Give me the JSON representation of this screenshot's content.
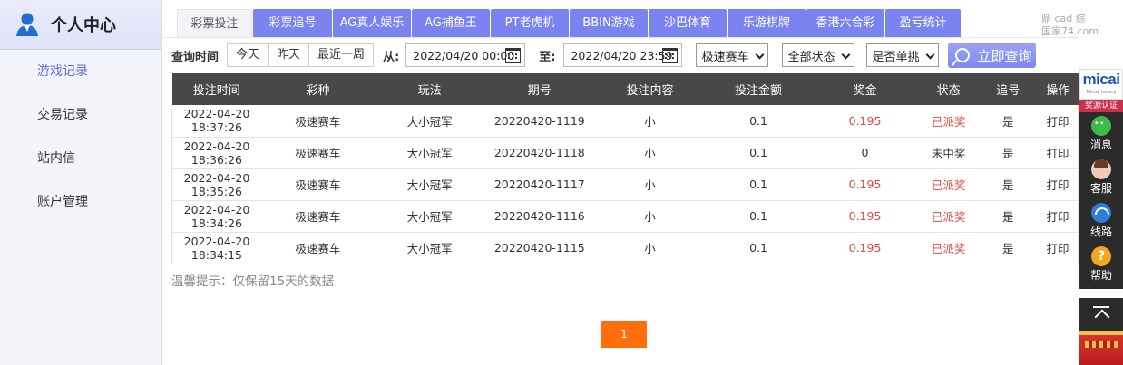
{
  "sidebar": {
    "title": "个人中心",
    "items": [
      {
        "label": "游戏记录",
        "active": true
      },
      {
        "label": "交易记录",
        "active": false
      },
      {
        "label": "站内信",
        "active": false
      },
      {
        "label": "账户管理",
        "active": false
      }
    ]
  },
  "tabs": [
    "彩票投注",
    "彩票追号",
    "AG真人娱乐",
    "AG捕鱼王",
    "PT老虎机",
    "BBIN游戏",
    "沙巴体育",
    "乐游棋牌",
    "香港六合彩",
    "盈亏统计"
  ],
  "filters": {
    "time_label": "查询时间",
    "quick": [
      "今天",
      "昨天",
      "最近一周"
    ],
    "from_label": "从:",
    "from_value": "2022/04/20 00:00",
    "to_label": "至:",
    "to_value": "2022/04/20 23:59",
    "game_select": "极速赛车",
    "status_select": "全部状态",
    "single_select": "是否单挑",
    "query_button": "立即查询"
  },
  "table": {
    "headers": [
      "投注时间",
      "彩种",
      "玩法",
      "期号",
      "投注内容",
      "投注金额",
      "奖金",
      "状态",
      "追号",
      "操作"
    ],
    "rows": [
      [
        "2022-04-20 18:37:26",
        "极速赛车",
        "大小冠军",
        "20220420-1119",
        "小",
        "0.1",
        "0.195",
        "已派奖",
        "是",
        "打印"
      ],
      [
        "2022-04-20 18:36:26",
        "极速赛车",
        "大小冠军",
        "20220420-1118",
        "小",
        "0.1",
        "0",
        "未中奖",
        "是",
        "打印"
      ],
      [
        "2022-04-20 18:35:26",
        "极速赛车",
        "大小冠军",
        "20220420-1117",
        "小",
        "0.1",
        "0.195",
        "已派奖",
        "是",
        "打印"
      ],
      [
        "2022-04-20 18:34:26",
        "极速赛车",
        "大小冠军",
        "20220420-1116",
        "小",
        "0.1",
        "0.195",
        "已派奖",
        "是",
        "打印"
      ],
      [
        "2022-04-20 18:34:15",
        "极速赛车",
        "大小冠军",
        "20220420-1115",
        "小",
        "0.1",
        "0.195",
        "已派奖",
        "是",
        "打印"
      ]
    ]
  },
  "tip": "温馨提示：仅保留15天的数据",
  "pagination": {
    "current": "1"
  },
  "watermark": {
    "line1": "鼎 cad 综",
    "line2": "国家74.com"
  },
  "right_panel": {
    "brand_logo": "micai",
    "brand_sub": "Mircai lottery",
    "cert": "奖源认证",
    "buttons": [
      "消息",
      "客服",
      "线路",
      "帮助"
    ]
  },
  "colors": {
    "accent": "#7b83f0",
    "won": "#e8463c",
    "pager": "#ff6f0c",
    "header": "#484848"
  }
}
